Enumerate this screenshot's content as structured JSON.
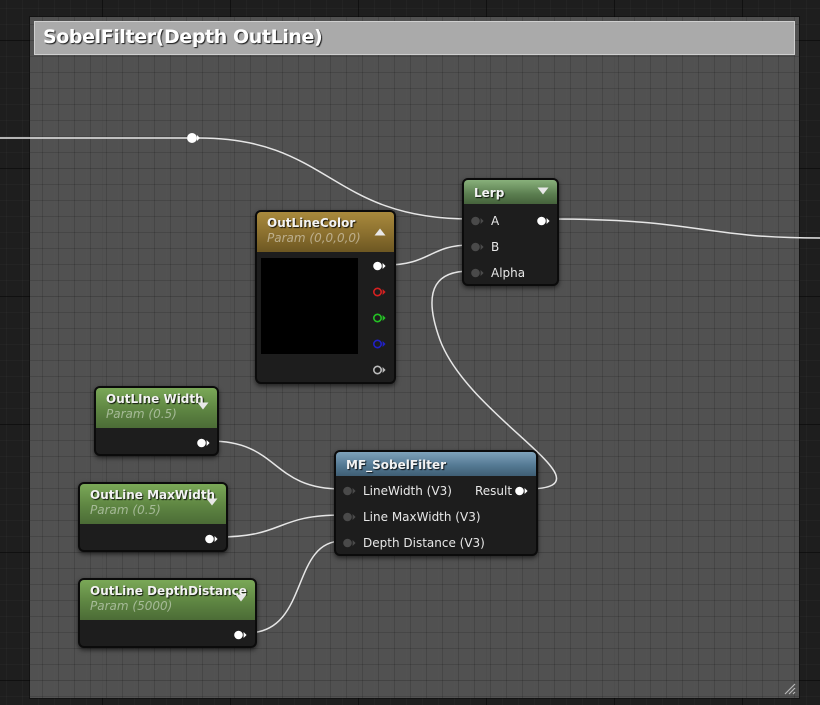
{
  "comment": {
    "title": "SobelFilter(Depth OutLine)",
    "color": "#aaaaaa"
  },
  "nodes": {
    "outline_color": {
      "title": "OutLineColor",
      "subtitle": "Param (0,0,0,0)",
      "value_color": "#000000"
    },
    "lerp": {
      "title": "Lerp",
      "pins": {
        "a": "A",
        "b": "B",
        "alpha": "Alpha"
      }
    },
    "outline_width": {
      "title": "OutLIne Width",
      "subtitle": "Param (0.5)"
    },
    "outline_maxwidth": {
      "title": "OutLine MaxWidth",
      "subtitle": "Param (0.5)"
    },
    "outline_depthdistance": {
      "title": "OutLine DepthDistance",
      "subtitle": "Param (5000)"
    },
    "mf_sobelfilter": {
      "title": "MF_SobelFilter",
      "pins": {
        "linewidth": "LineWidth (V3)",
        "line_maxwidth": "Line MaxWidth (V3)",
        "depth_distance": "Depth Distance (V3)",
        "result": "Result"
      }
    }
  },
  "colors": {
    "wire": "#e6e6e6",
    "pin_white": "#ffffff",
    "pin_red": "#d62020",
    "pin_green": "#24c224",
    "pin_blue": "#2020c8",
    "pin_alpha": "#bbbbbb",
    "pin_unconnected": "#505050"
  }
}
